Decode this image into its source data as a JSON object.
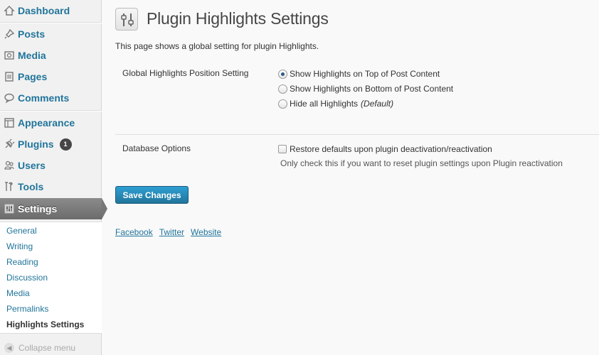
{
  "sidebar": {
    "items": [
      {
        "label": "Dashboard",
        "icon": "dashboard-icon"
      },
      {
        "label": "Posts",
        "icon": "pin-icon"
      },
      {
        "label": "Media",
        "icon": "media-icon"
      },
      {
        "label": "Pages",
        "icon": "pages-icon"
      },
      {
        "label": "Comments",
        "icon": "comment-icon"
      },
      {
        "label": "Appearance",
        "icon": "appearance-icon"
      },
      {
        "label": "Plugins",
        "icon": "plugin-icon",
        "badge": "1"
      },
      {
        "label": "Users",
        "icon": "users-icon"
      },
      {
        "label": "Tools",
        "icon": "tools-icon"
      },
      {
        "label": "Settings",
        "icon": "settings-icon"
      }
    ],
    "submenu": [
      "General",
      "Writing",
      "Reading",
      "Discussion",
      "Media",
      "Permalinks",
      "Highlights Settings"
    ],
    "collapse_label": "Collapse menu"
  },
  "page": {
    "title": "Plugin Highlights Settings",
    "description": "This page shows a global setting for plugin Highlights."
  },
  "position_setting": {
    "label": "Global Highlights Position Setting",
    "options": [
      "Show Highlights on Top of Post Content",
      "Show Highlights on Bottom of Post Content",
      "Hide all Highlights"
    ],
    "default_suffix": "(Default)",
    "selected_index": 0
  },
  "database": {
    "label": "Database Options",
    "checkbox_label": "Restore defaults upon plugin deactivation/reactivation",
    "checked": false,
    "hint": "Only check this if you want to reset plugin settings upon Plugin reactivation"
  },
  "save_label": "Save Changes",
  "links": [
    "Facebook",
    "Twitter",
    "Website"
  ],
  "colors": {
    "link": "#21759b",
    "button": "#21759b",
    "active_menu": "#6b6b6b"
  }
}
